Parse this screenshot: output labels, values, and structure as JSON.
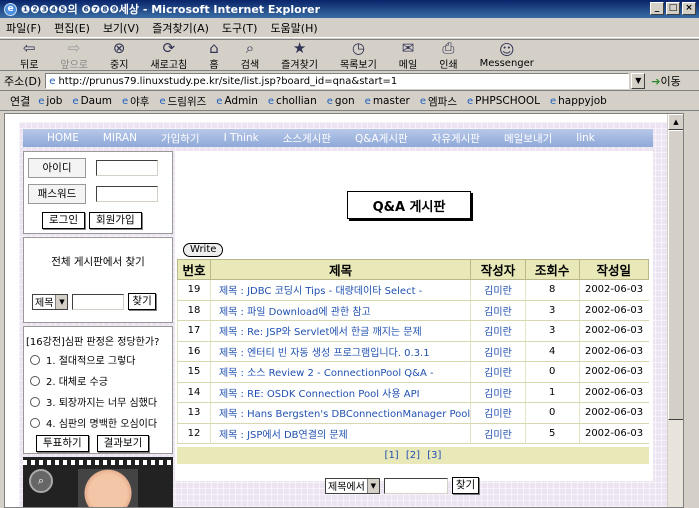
{
  "window": {
    "title": "❶❷❸❹❺의 ❻❼❽❾세상 - Microsoft Internet Explorer",
    "minimize": "_",
    "maximize": "□",
    "close": "×"
  },
  "menu": [
    "파일(F)",
    "편집(E)",
    "보기(V)",
    "즐겨찾기(A)",
    "도구(T)",
    "도움말(H)"
  ],
  "toolbar": {
    "back": "뒤로",
    "forward": "앞으로",
    "stop": "중지",
    "refresh": "새로고침",
    "home": "홈",
    "search": "검색",
    "favorites": "즐겨찾기",
    "history": "목록보기",
    "mail": "메일",
    "print": "인쇄",
    "messenger": "Messenger"
  },
  "address": {
    "label": "주소(D)",
    "url": "http://prunus79.linuxstudy.pe.kr/site/list.jsp?board_id=qna&start=1",
    "go": "이동"
  },
  "links": {
    "label": "연결",
    "items": [
      "job",
      "Daum",
      "야후",
      "드림위즈",
      "Admin",
      "chollian",
      "gon",
      "master",
      "엠파스",
      "PHPSCHOOL",
      "happyjob"
    ]
  },
  "topnav": [
    "HOME",
    "MIRAN",
    "가입하기",
    "I Think",
    "소스게시판",
    "Q&A게시판",
    "자유게시판",
    "메일보내기",
    "link"
  ],
  "login": {
    "id_label": "아이디",
    "pw_label": "패스워드",
    "login_btn": "로그인",
    "join_btn": "회원가입"
  },
  "site_search": {
    "title": "전체 게시판에서 찾기",
    "select": "제목",
    "button": "찾기"
  },
  "poll": {
    "question": "[16강전]심판 판정은 정당한가?",
    "options": [
      "1. 절대적으로 그렇다",
      "2. 대체로 수긍",
      "3. 퇴장까지는 너무 심했다",
      "4. 심판의 명백한 오심이다"
    ],
    "vote_btn": "투표하기",
    "result_btn": "결과보기"
  },
  "board": {
    "title": "Q&A 게시판",
    "write_btn": "Write",
    "headers": [
      "번호",
      "제목",
      "작성자",
      "조회수",
      "작성일"
    ],
    "rows": [
      {
        "no": "19",
        "title": "제목 : JDBC 코딩시 Tips - 대량데이타 Select -",
        "author": "김미란",
        "views": "8",
        "date": "2002-06-03"
      },
      {
        "no": "18",
        "title": "제목 : 파일 Download에 관한 참고",
        "author": "김미란",
        "views": "3",
        "date": "2002-06-03"
      },
      {
        "no": "17",
        "title": "제목 : Re: JSP와 Servlet에서 한글 깨지는 문제",
        "author": "김미란",
        "views": "3",
        "date": "2002-06-03"
      },
      {
        "no": "16",
        "title": "제목 : 엔터티 빈 자동 생성 프로그램입니다. 0.3.1",
        "author": "김미란",
        "views": "4",
        "date": "2002-06-03"
      },
      {
        "no": "15",
        "title": "제목 : 소스 Review 2 - ConnectionPool Q&A -",
        "author": "김미란",
        "views": "0",
        "date": "2002-06-03"
      },
      {
        "no": "14",
        "title": "제목 : RE: OSDK Connection Pool 사용 API",
        "author": "김미란",
        "views": "1",
        "date": "2002-06-03"
      },
      {
        "no": "13",
        "title": "제목 : Hans Bergsten's DBConnectionManager Pool",
        "author": "김미란",
        "views": "0",
        "date": "2002-06-03"
      },
      {
        "no": "12",
        "title": "제목 : JSP에서 DB연결의 문제",
        "author": "김미란",
        "views": "5",
        "date": "2002-06-03"
      }
    ],
    "pages": [
      "[1]",
      "[2]",
      "[3]"
    ]
  },
  "board_search": {
    "select": "제목에서",
    "button": "찾기"
  }
}
